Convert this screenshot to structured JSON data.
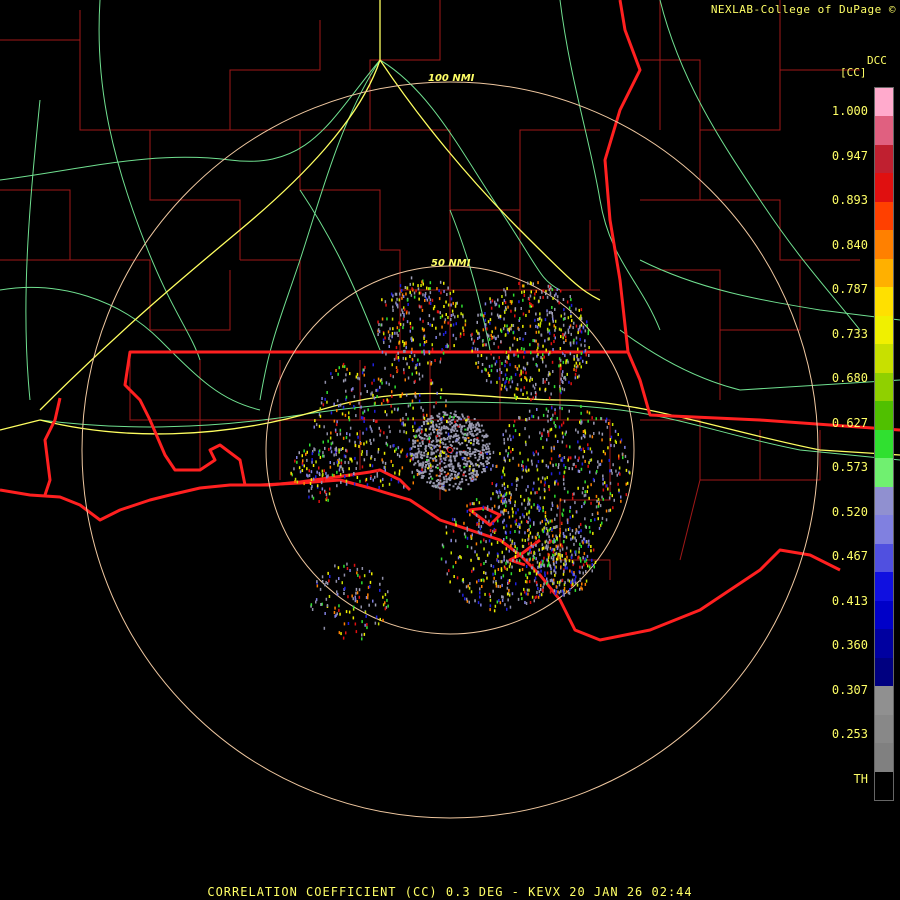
{
  "header": {
    "credit": "NEXLAB-College of DuPage ©"
  },
  "footer": {
    "caption": "CORRELATION COEFFICIENT (CC) 0.3 DEG - KEVX 20 JAN 26 02:44"
  },
  "scale": {
    "station": "DCC",
    "units": "[CC]",
    "labels": [
      "1.000",
      "0.947",
      "0.893",
      "0.840",
      "0.787",
      "0.733",
      "0.680",
      "0.627",
      "0.573",
      "0.520",
      "0.467",
      "0.413",
      "0.360",
      "0.307",
      "0.253",
      "TH"
    ],
    "colors": [
      "#ffaacc",
      "#e06080",
      "#c02030",
      "#e01010",
      "#ff4000",
      "#ff8000",
      "#ffb000",
      "#ffe000",
      "#f0f000",
      "#c8e000",
      "#90d000",
      "#50c000",
      "#30e030",
      "#70f070",
      "#9090d0",
      "#8080e0",
      "#5050e0",
      "#1010e0",
      "#0000c8",
      "#0000a0",
      "#000080",
      "#909090",
      "#888888",
      "#808080",
      "#000000"
    ]
  },
  "rings": [
    {
      "label": "100 NMI",
      "range_nmi": 100
    },
    {
      "label": "50 NMI",
      "range_nmi": 50
    }
  ],
  "colors": {
    "state_border": "#ff2020",
    "county_border": "#a01818",
    "highway": "#ffff60",
    "road": "#70e090",
    "range_ring": "#f0c8a0",
    "text": "#ffff66"
  }
}
